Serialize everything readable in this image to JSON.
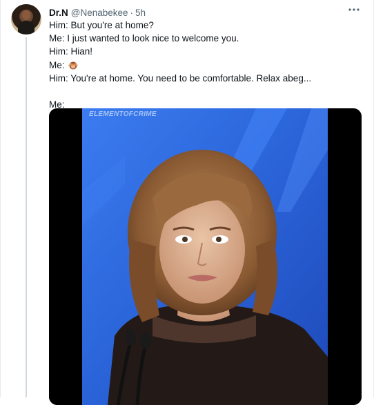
{
  "tweet": {
    "display_name": "Dr.N",
    "handle": "@Nenabekee",
    "separator": "·",
    "time": "5h",
    "more_icon": "more-horizontal-icon",
    "lines": [
      "Him: But you're at home?",
      "Me: I just wanted to look nice to welcome you.",
      "Him: Hian!",
      "Me:",
      "Him: You're at home. You need to be comfortable. Relax abeg...",
      "",
      "Me:"
    ],
    "emoji_name": "see-no-evil-monkey-icon",
    "media": {
      "watermark": "ELEMENTOFCRIME"
    }
  },
  "colors": {
    "name": "#0f1419",
    "secondary": "#536471",
    "border": "#e6ecf0",
    "thread_line": "#cfd9de",
    "media_backdrop": "#2c5fd6"
  }
}
